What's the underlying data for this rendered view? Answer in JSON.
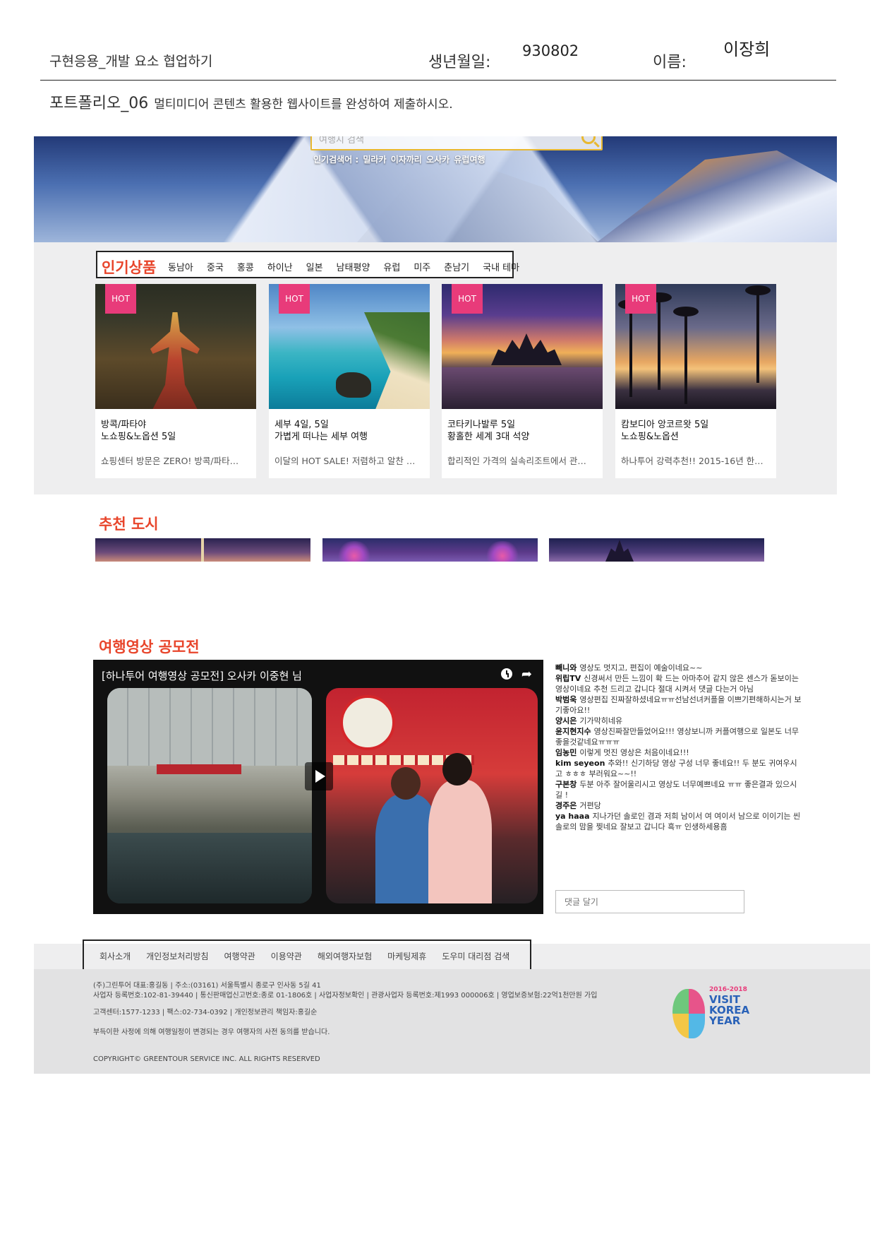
{
  "worksheet": {
    "subject": "구현응용_개발 요소 협업하기",
    "birth_label": "생년월일:",
    "birth_value": "930802",
    "name_label": "이름:",
    "name_value": "이장희",
    "task_title": "포트폴리오_06",
    "task_desc": "멀티미디어 콘텐츠 활용한 웹사이트를 완성하여 제출하시오."
  },
  "hero": {
    "search_placeholder": "여행지 검색",
    "keywords_label": "인기검색어 :",
    "keywords": [
      "밀라카",
      "이자까리",
      "오사카",
      "유럽여행"
    ]
  },
  "popular": {
    "title": "인기상품",
    "tabs": [
      "동남아",
      "중국",
      "홍콩",
      "하이난",
      "일본",
      "남태평양",
      "유럽",
      "미주",
      "춘남기",
      "국내 테마"
    ],
    "cards": [
      {
        "badge": "HOT",
        "title1": "방콕/파타야",
        "title2": "노쇼핑&노옵션 5일",
        "desc": "쇼핑센터 방문은 ZERO! 방콕/파타…"
      },
      {
        "badge": "HOT",
        "title1": "세부 4일, 5일",
        "title2": "가볍게 떠나는 세부 여행",
        "desc": "이달의 HOT SALE! 저렴하고 알찬 …"
      },
      {
        "badge": "HOT",
        "title1": "코타키나발루 5일",
        "title2": "황홀한 세계 3대 석양",
        "desc": "합리적인 가격의 실속리조트에서 관…"
      },
      {
        "badge": "HOT",
        "title1": "캄보디아 앙코르왓 5일",
        "title2": "노쇼핑&노옵션",
        "desc": "하나투어 강력추천!! 2015-16년 한…"
      }
    ]
  },
  "cities": {
    "title": "추천 도시"
  },
  "video": {
    "title": "여행영상 공모전",
    "caption": "[하나투어 여행영상 공모전] 오사카 이중현 님"
  },
  "comments": [
    {
      "author": "빼니와",
      "text": "영상도 멋지고, 편집이 예술이네요~~"
    },
    {
      "author": "위립TV",
      "text": "신경써서 만든 느낌이 확 드는 아마추어 같지 않은 센스가 돋보이는 영상이네요 추천 드리고 갑니다 절대 시켜서 댓글 다는거 아님"
    },
    {
      "author": "박범욱",
      "text": "영상편집 진짜잘하셨네요ㅠㅠ선남선녀커플을 이쁘기편해하시는거 보기좋아요!!"
    },
    {
      "author": "양시은",
      "text": "기가막히네유"
    },
    {
      "author": "윤지현지수",
      "text": "영상진짜잘만들었어요!!! 영상보니까 커플여행으로 일본도 너무 좋을것같네요ㅠㅠㅠ"
    },
    {
      "author": "임농민",
      "text": "이렇게 멋진 영상은 처음이네요!!!"
    },
    {
      "author": "kim seyeon",
      "text": "추와!! 신기하당 영상 구성 너무 좋네요!! 두 분도 귀여우시고 ㅎㅎㅎ 부러워요~~!!"
    },
    {
      "author": "구본창",
      "text": "두분 아주 잘어울리시고 영상도 너무예쁘네요 ㅠㅠ 좋은결과 있으시길 !"
    },
    {
      "author": "경주은",
      "text": "거편당"
    },
    {
      "author": "ya haaa",
      "text": "지나가던 솔로인 겸과 저희 남이서 여 여이서 남으로 이이기는 씬 솔로의 맘을 찢네요 잘보고 갑니다 흑ㅠ 인생하세용흠"
    }
  ],
  "comment_input": {
    "placeholder": "댓글 달기"
  },
  "footer": {
    "links": [
      "회사소개",
      "개인정보처리방침",
      "여행약관",
      "이용약관",
      "해외여행자보험",
      "마케팅제휴",
      "도우미 대리점 검색"
    ],
    "line1": "(주)그린투어 대표:홍길동 | 주소:(03161) 서울특별시 종로구 인사동 5길 41",
    "line2": "사업자 등록번호:102-81-39440 | 통신판매업신고번호:종로 01-1806호 | 사업자정보확인 | 관광사업자 등록번호:제1993 000006호 | 영업보증보험:22억1천만원 가입",
    "line3": "고객센터:1577-1233 | 팩스:02-734-0392 | 개인정보관리 책임자:홍길순",
    "line4": "부득이한 사정에 의해 여행일정이 변경되는 경우 여행자의 사전 동의를 받습니다.",
    "copyright": "COPYRIGHT© GREENTOUR SERVICE INC. ALL RIGHTS RESERVED",
    "logo_years": "2016-2018",
    "logo_text": "VISIT KOREA YEAR"
  },
  "colors": {
    "accent": "#e8452b",
    "hot_badge": "#e83b7a",
    "section_bg": "#eeeeef"
  }
}
